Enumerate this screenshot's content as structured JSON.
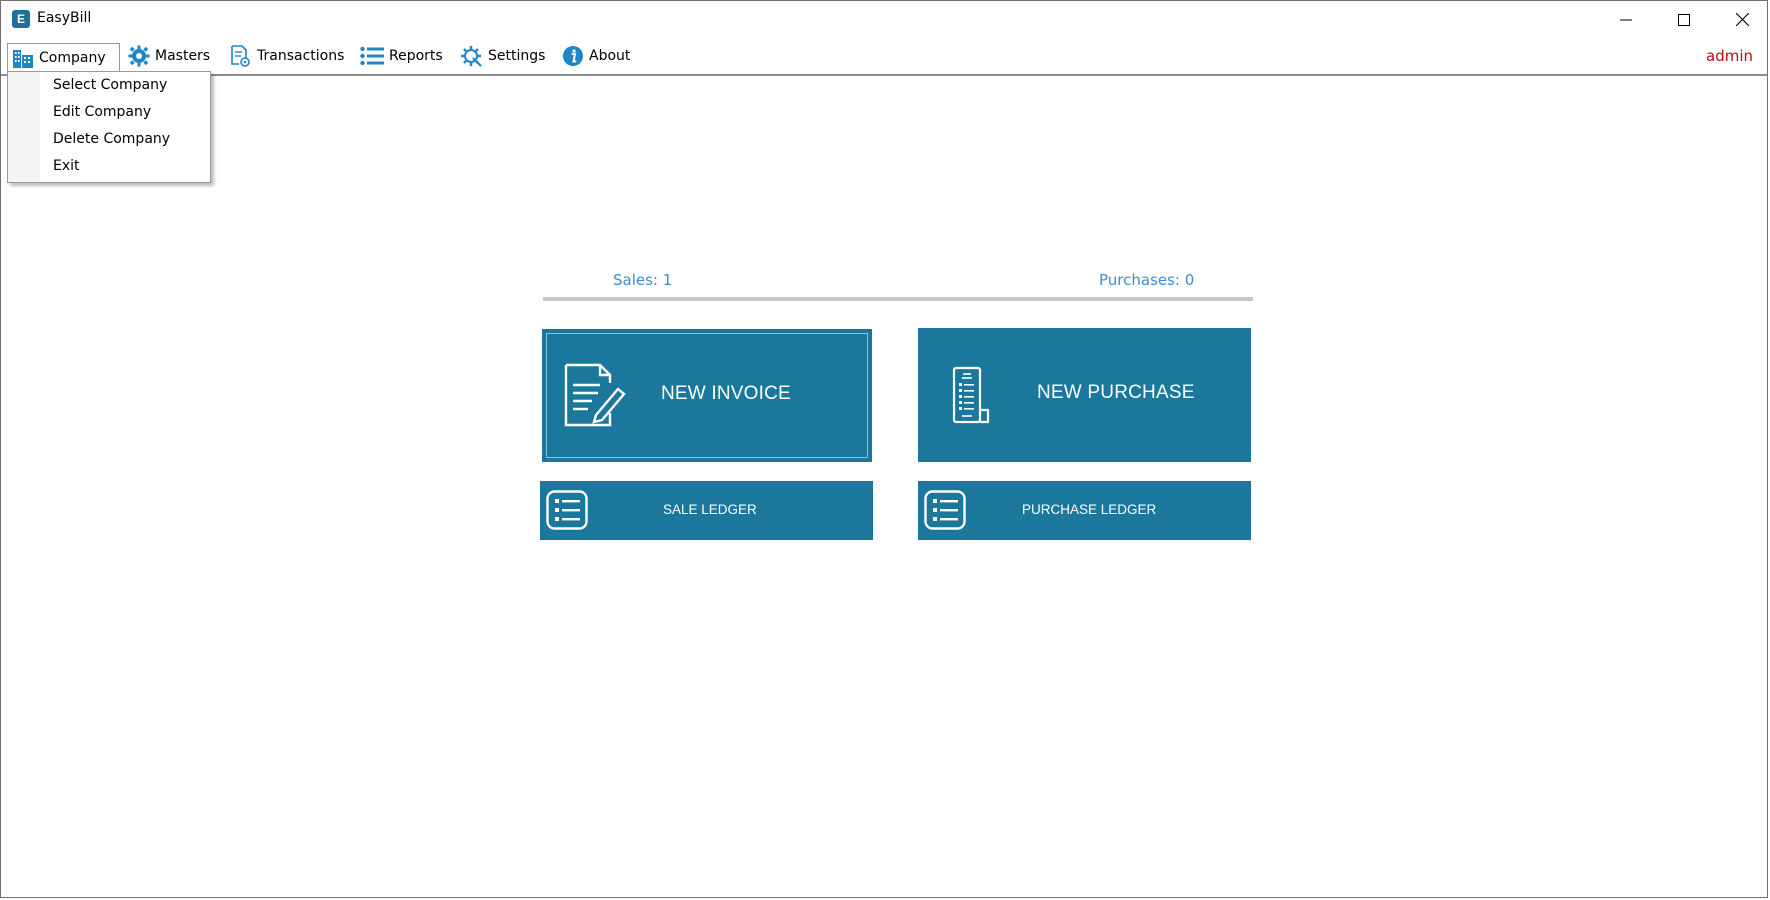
{
  "window": {
    "title": "EasyBill",
    "app_icon_letter": "E"
  },
  "menubar": {
    "items": [
      {
        "label": "Company",
        "icon": "building-icon"
      },
      {
        "label": "Masters",
        "icon": "gear-icon"
      },
      {
        "label": "Transactions",
        "icon": "document-gear-icon"
      },
      {
        "label": "Reports",
        "icon": "list-icon"
      },
      {
        "label": "Settings",
        "icon": "tools-icon"
      },
      {
        "label": "About",
        "icon": "info-icon"
      }
    ],
    "user": "admin"
  },
  "company_menu": {
    "items": [
      "Select Company",
      "Edit Company",
      "Delete Company",
      "Exit"
    ]
  },
  "stats": {
    "sales": "Sales: 1",
    "purchases": "Purchases: 0"
  },
  "tiles": {
    "new_invoice": "NEW INVOICE",
    "new_purchase": "NEW PURCHASE",
    "sale_ledger": "SALE LEDGER",
    "purchase_ledger": "PURCHASE LEDGER"
  },
  "colors": {
    "tile": "#1b779c",
    "stat_text": "#3b8fd1",
    "user_text": "#b01010",
    "menu_icon": "#1f86c6"
  }
}
